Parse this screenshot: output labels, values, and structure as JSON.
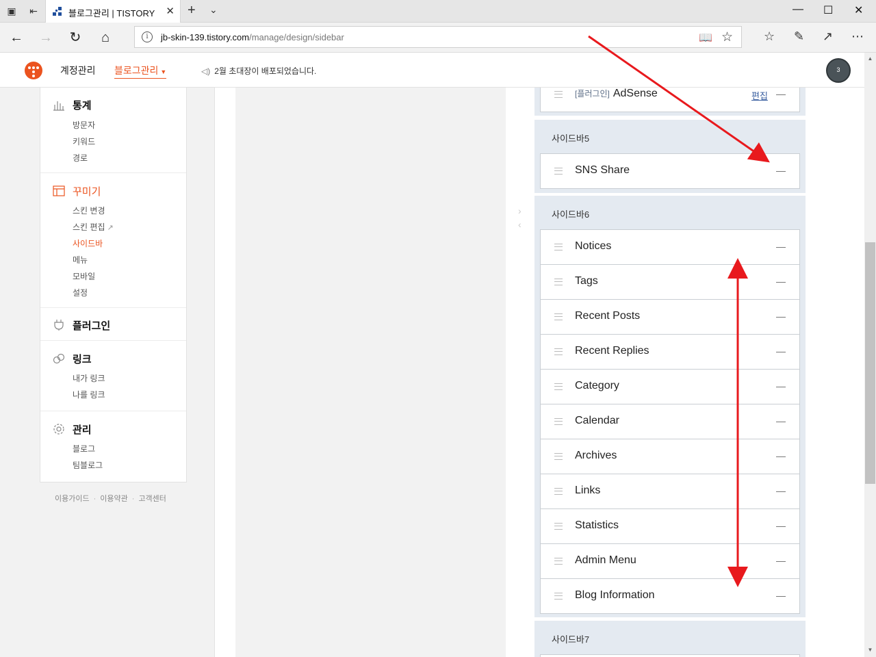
{
  "browser": {
    "tab_title": "블로그관리 | TISTORY",
    "url_host": "jb-skin-139.tistory.com",
    "url_path": "/manage/design/sidebar"
  },
  "header": {
    "account": "계정관리",
    "blog_manage": "블로그관리",
    "notice": "2월 초대장이 배포되었습니다.",
    "avatar_badge": "3"
  },
  "sidebar": {
    "groups": [
      {
        "label": "통계",
        "icon": "chart-icon",
        "items": [
          "방문자",
          "키워드",
          "경로"
        ]
      },
      {
        "label": "꾸미기",
        "icon": "layout-icon",
        "items": [
          "스킨 변경",
          "스킨 편집",
          "사이드바",
          "메뉴",
          "모바일",
          "설정"
        ]
      },
      {
        "label": "플러그인",
        "icon": "plug-icon",
        "items": []
      },
      {
        "label": "링크",
        "icon": "link-icon",
        "items": [
          "내가 링크",
          "나를 링크"
        ]
      },
      {
        "label": "관리",
        "icon": "gear-icon",
        "items": [
          "블로그",
          "팀블로그"
        ]
      }
    ],
    "active_item": "사이드바",
    "footer": [
      "이용가이드",
      "이용약관",
      "고객센터"
    ]
  },
  "main": {
    "top_item": {
      "prefix": "[플러그인]",
      "name": "AdSense",
      "edit": "편집"
    },
    "sidebar5": {
      "title": "사이드바5",
      "items": [
        "SNS Share"
      ]
    },
    "sidebar6": {
      "title": "사이드바6",
      "items": [
        "Notices",
        "Tags",
        "Recent Posts",
        "Recent Replies",
        "Category",
        "Calendar",
        "Archives",
        "Links",
        "Statistics",
        "Admin Menu",
        "Blog Information"
      ]
    },
    "sidebar7": {
      "title": "사이드바7"
    }
  },
  "colors": {
    "accent": "#eb531f",
    "panel": "#e4eaf1",
    "arrow": "#e8191d"
  }
}
